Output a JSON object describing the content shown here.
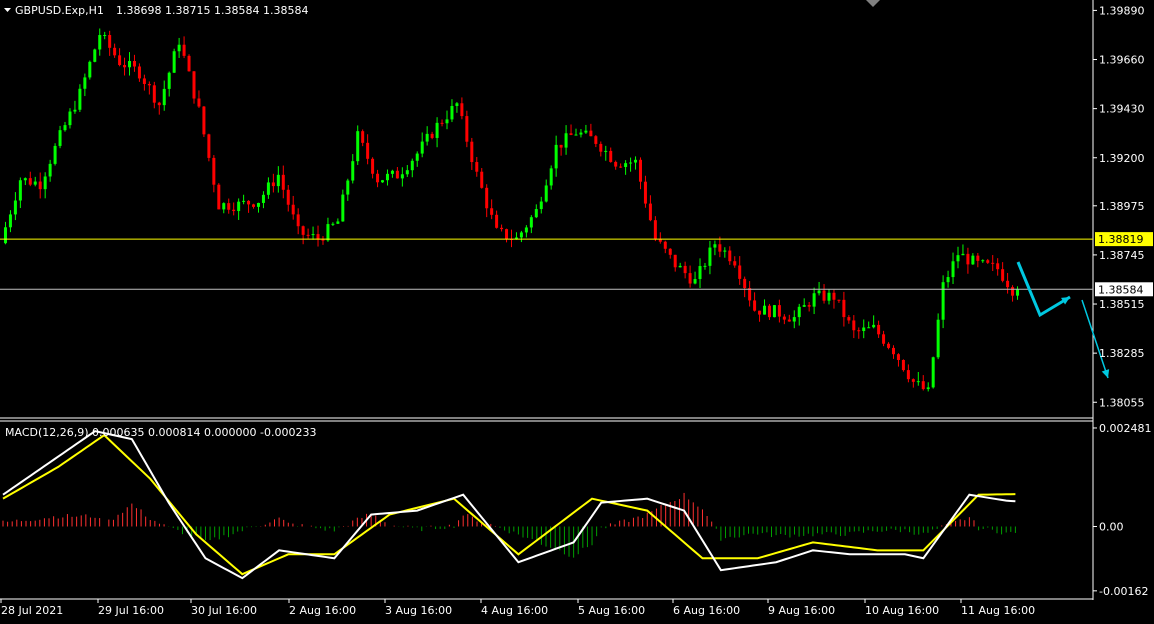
{
  "window": {
    "symbol_label": "GBPUSD.Exp,H1",
    "ohlc_label": "1.38698 1.38715 1.38584 1.38584",
    "macd_label": "MACD(12,26,9) 0.000635 0.000814 0.000000 -0.000233"
  },
  "colors": {
    "background": "#000000",
    "bull": "#00ff00",
    "bear": "#ff0000",
    "wick": "#ffffff",
    "axis": "#ffffff",
    "level_line": "#ffff00",
    "bid_line": "#c0c0c0",
    "current_price_tag": "#ffff00",
    "macd_line": "#ffffff",
    "signal_line": "#ffff00",
    "hist_positive": "#ff3030",
    "hist_negative": "#00a000",
    "arrows": "#00c8e0"
  },
  "price_axis": {
    "ticks": [
      "1.39890",
      "1.39660",
      "1.39430",
      "1.39200",
      "1.38975",
      "1.38745",
      "1.38515",
      "1.38285",
      "1.38055"
    ]
  },
  "macd_axis": {
    "ticks": [
      "0.002481",
      "0.00",
      "-0.00162"
    ]
  },
  "time_axis": {
    "labels": [
      "28 Jul 2021",
      "29 Jul 16:00",
      "30 Jul 16:00",
      "2 Aug 16:00",
      "3 Aug 16:00",
      "4 Aug 16:00",
      "5 Aug 16:00",
      "6 Aug 16:00",
      "9 Aug 16:00",
      "10 Aug 16:00",
      "11 Aug 16:00"
    ]
  },
  "levels": {
    "resistance_label": "1.38819",
    "current_label": "1.38584"
  },
  "chart_data": [
    {
      "type": "candlestick",
      "title": "GBPUSD.Exp,H1",
      "ylim": [
        1.38,
        1.3992
      ],
      "x_range_bars": [
        0,
        230
      ],
      "tick_values": [
        1.3989,
        1.3966,
        1.3943,
        1.392,
        1.38975,
        1.38745,
        1.38515,
        1.38285,
        1.38055
      ],
      "anchors": [
        {
          "bar": 0,
          "price": 1.388
        },
        {
          "bar": 4,
          "price": 1.391
        },
        {
          "bar": 8,
          "price": 1.3908
        },
        {
          "bar": 12,
          "price": 1.393
        },
        {
          "bar": 16,
          "price": 1.395
        },
        {
          "bar": 20,
          "price": 1.3978
        },
        {
          "bar": 24,
          "price": 1.3965
        },
        {
          "bar": 28,
          "price": 1.396
        },
        {
          "bar": 32,
          "price": 1.3945
        },
        {
          "bar": 36,
          "price": 1.3975
        },
        {
          "bar": 40,
          "price": 1.3942
        },
        {
          "bar": 44,
          "price": 1.3898
        },
        {
          "bar": 48,
          "price": 1.3898
        },
        {
          "bar": 52,
          "price": 1.39
        },
        {
          "bar": 56,
          "price": 1.3912
        },
        {
          "bar": 60,
          "price": 1.3885
        },
        {
          "bar": 64,
          "price": 1.3882
        },
        {
          "bar": 68,
          "price": 1.389
        },
        {
          "bar": 72,
          "price": 1.393
        },
        {
          "bar": 76,
          "price": 1.391
        },
        {
          "bar": 80,
          "price": 1.3912
        },
        {
          "bar": 84,
          "price": 1.3922
        },
        {
          "bar": 88,
          "price": 1.3935
        },
        {
          "bar": 92,
          "price": 1.3945
        },
        {
          "bar": 96,
          "price": 1.3912
        },
        {
          "bar": 100,
          "price": 1.3885
        },
        {
          "bar": 104,
          "price": 1.3882
        },
        {
          "bar": 108,
          "price": 1.3895
        },
        {
          "bar": 112,
          "price": 1.3925
        },
        {
          "bar": 116,
          "price": 1.3932
        },
        {
          "bar": 120,
          "price": 1.3928
        },
        {
          "bar": 124,
          "price": 1.3918
        },
        {
          "bar": 128,
          "price": 1.3918
        },
        {
          "bar": 132,
          "price": 1.3882
        },
        {
          "bar": 136,
          "price": 1.387
        },
        {
          "bar": 140,
          "price": 1.3862
        },
        {
          "bar": 144,
          "price": 1.388
        },
        {
          "bar": 148,
          "price": 1.3872
        },
        {
          "bar": 152,
          "price": 1.3849
        },
        {
          "bar": 156,
          "price": 1.3848
        },
        {
          "bar": 160,
          "price": 1.3845
        },
        {
          "bar": 164,
          "price": 1.3855
        },
        {
          "bar": 168,
          "price": 1.3855
        },
        {
          "bar": 172,
          "price": 1.3838
        },
        {
          "bar": 176,
          "price": 1.384
        },
        {
          "bar": 180,
          "price": 1.383
        },
        {
          "bar": 184,
          "price": 1.3815
        },
        {
          "bar": 187,
          "price": 1.381
        },
        {
          "bar": 190,
          "price": 1.386
        },
        {
          "bar": 193,
          "price": 1.3875
        },
        {
          "bar": 197,
          "price": 1.387
        },
        {
          "bar": 201,
          "price": 1.3868
        },
        {
          "bar": 204,
          "price": 1.38584
        }
      ],
      "last_close": 1.38584,
      "resistance_level": 1.38819,
      "current_level": 1.38584,
      "forecast_arrows": [
        {
          "points": [
            [
              1018,
              262
            ],
            [
              1040,
              315
            ],
            [
              1070,
              297
            ]
          ]
        },
        {
          "points": [
            [
              1082,
              300
            ],
            [
              1108,
              378
            ]
          ]
        }
      ]
    },
    {
      "type": "macd",
      "title": "MACD(12,26,9)",
      "ylim": [
        -0.00175,
        0.00258
      ],
      "values": {
        "main": 0.000635,
        "signal": 0.000814,
        "histogram": 0.0,
        "extra": -0.000233
      },
      "macd_anchors": [
        {
          "bar": 0,
          "v": 0.0008
        },
        {
          "bar": 10,
          "v": 0.0016
        },
        {
          "bar": 20,
          "v": 0.0024
        },
        {
          "bar": 28,
          "v": 0.0022
        },
        {
          "bar": 36,
          "v": 0.0006
        },
        {
          "bar": 44,
          "v": -0.0008
        },
        {
          "bar": 52,
          "v": -0.0013
        },
        {
          "bar": 60,
          "v": -0.0006
        },
        {
          "bar": 72,
          "v": -0.0008
        },
        {
          "bar": 80,
          "v": 0.0003
        },
        {
          "bar": 90,
          "v": 0.0004
        },
        {
          "bar": 100,
          "v": 0.0008
        },
        {
          "bar": 112,
          "v": -0.0009
        },
        {
          "bar": 124,
          "v": -0.0004
        },
        {
          "bar": 130,
          "v": 0.0006
        },
        {
          "bar": 140,
          "v": 0.0007
        },
        {
          "bar": 148,
          "v": 0.0004
        },
        {
          "bar": 156,
          "v": -0.0011
        },
        {
          "bar": 168,
          "v": -0.0009
        },
        {
          "bar": 176,
          "v": -0.0006
        },
        {
          "bar": 184,
          "v": -0.0007
        },
        {
          "bar": 196,
          "v": -0.0007
        },
        {
          "bar": 200,
          "v": -0.0008
        },
        {
          "bar": 210,
          "v": 0.0008
        },
        {
          "bar": 218,
          "v": 0.00065
        },
        {
          "bar": 220,
          "v": 0.000635
        }
      ],
      "signal_anchors": [
        {
          "bar": 0,
          "v": 0.0007
        },
        {
          "bar": 12,
          "v": 0.0015
        },
        {
          "bar": 22,
          "v": 0.0023
        },
        {
          "bar": 32,
          "v": 0.0012
        },
        {
          "bar": 42,
          "v": -0.0002
        },
        {
          "bar": 52,
          "v": -0.0012
        },
        {
          "bar": 62,
          "v": -0.0007
        },
        {
          "bar": 72,
          "v": -0.0007
        },
        {
          "bar": 84,
          "v": 0.0003
        },
        {
          "bar": 98,
          "v": 0.0007
        },
        {
          "bar": 112,
          "v": -0.0007
        },
        {
          "bar": 128,
          "v": 0.0007
        },
        {
          "bar": 140,
          "v": 0.0004
        },
        {
          "bar": 152,
          "v": -0.0008
        },
        {
          "bar": 164,
          "v": -0.0008
        },
        {
          "bar": 176,
          "v": -0.0004
        },
        {
          "bar": 190,
          "v": -0.0006
        },
        {
          "bar": 200,
          "v": -0.0006
        },
        {
          "bar": 212,
          "v": 0.0008
        },
        {
          "bar": 220,
          "v": 0.000814
        }
      ]
    }
  ]
}
